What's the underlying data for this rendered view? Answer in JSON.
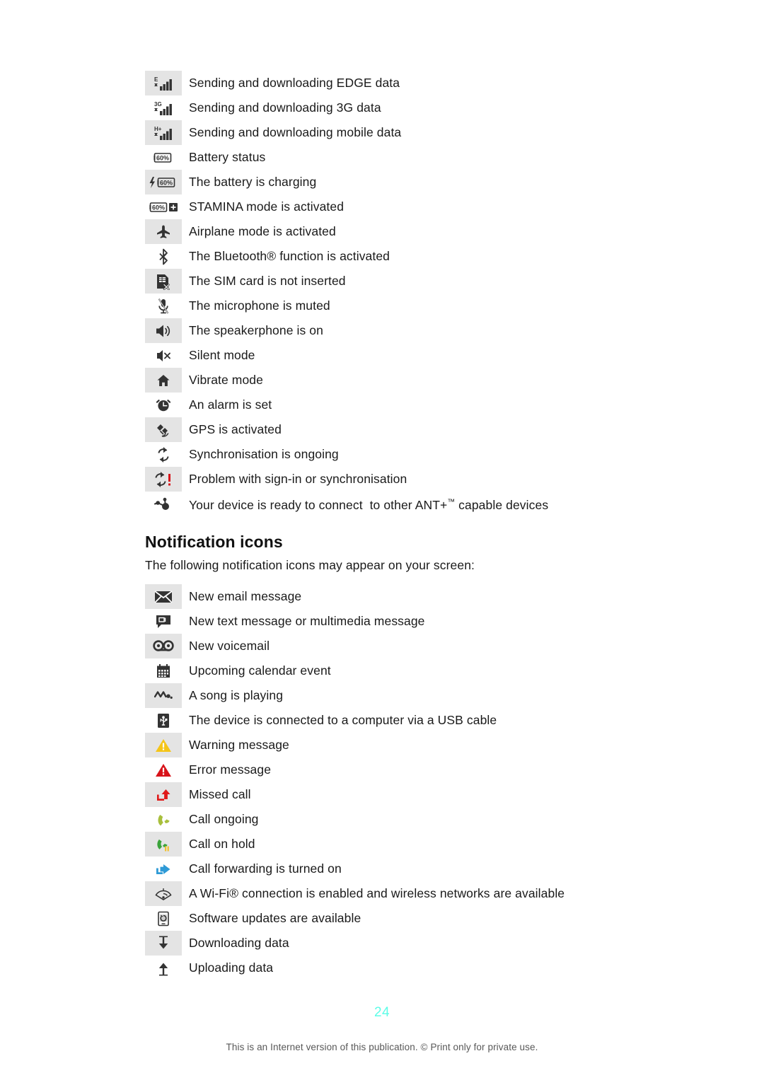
{
  "document": {
    "page_number": "24",
    "footer_note": "This is an Internet version of this publication. © Print only for private use."
  },
  "status_icons": {
    "rows": [
      {
        "icon": "edge-data-signal-icon",
        "label": "E",
        "description": "Sending and downloading EDGE data"
      },
      {
        "icon": "3g-data-signal-icon",
        "label": "3G",
        "description": "Sending and downloading 3G data"
      },
      {
        "icon": "mobile-data-signal-icon",
        "label": "H+",
        "description": "Sending and downloading mobile data"
      },
      {
        "icon": "battery-status-icon",
        "label": "60%",
        "description": "Battery status"
      },
      {
        "icon": "battery-charging-icon",
        "label": "60%",
        "description": "The battery is charging"
      },
      {
        "icon": "stamina-mode-icon",
        "label": "60%",
        "description": "STAMINA mode is activated"
      },
      {
        "icon": "airplane-mode-icon",
        "label": "",
        "description": "Airplane mode is activated"
      },
      {
        "icon": "bluetooth-icon",
        "label": "",
        "description": "The Bluetooth® function is activated"
      },
      {
        "icon": "sim-card-missing-icon",
        "label": "",
        "description": "The SIM card is not inserted"
      },
      {
        "icon": "microphone-muted-icon",
        "label": "",
        "description": "The microphone is muted"
      },
      {
        "icon": "speakerphone-icon",
        "label": "",
        "description": "The speakerphone is on"
      },
      {
        "icon": "silent-mode-icon",
        "label": "",
        "description": "Silent mode"
      },
      {
        "icon": "vibrate-mode-icon",
        "label": "",
        "description": "Vibrate mode"
      },
      {
        "icon": "alarm-set-icon",
        "label": "",
        "description": "An alarm is set"
      },
      {
        "icon": "gps-activated-icon",
        "label": "",
        "description": "GPS is activated"
      },
      {
        "icon": "sync-ongoing-icon",
        "label": "",
        "description": "Synchronisation is ongoing"
      },
      {
        "icon": "sync-problem-icon",
        "label": "",
        "description": "Problem with sign-in or synchronisation"
      },
      {
        "icon": "ant-plus-icon",
        "label": "",
        "description": "Your device is ready to connect  to other ANT+™ capable devices"
      }
    ]
  },
  "notification_section": {
    "heading": "Notification icons",
    "intro": "The following notification icons may appear on your screen:",
    "rows": [
      {
        "icon": "new-email-icon",
        "description": "New email message"
      },
      {
        "icon": "new-text-message-icon",
        "description": "New text message or multimedia message"
      },
      {
        "icon": "new-voicemail-icon",
        "description": "New voicemail"
      },
      {
        "icon": "calendar-event-icon",
        "description": "Upcoming calendar event"
      },
      {
        "icon": "music-playing-icon",
        "description": "A song is playing"
      },
      {
        "icon": "usb-connected-icon",
        "description": "The device is connected to a computer via a USB cable"
      },
      {
        "icon": "warning-icon",
        "description": "Warning message"
      },
      {
        "icon": "error-icon",
        "description": "Error message"
      },
      {
        "icon": "missed-call-icon",
        "description": "Missed call"
      },
      {
        "icon": "call-ongoing-icon",
        "description": "Call ongoing"
      },
      {
        "icon": "call-on-hold-icon",
        "description": "Call on hold"
      },
      {
        "icon": "call-forwarding-icon",
        "description": "Call forwarding is turned on"
      },
      {
        "icon": "wifi-available-icon",
        "description": "A Wi-Fi® connection is enabled and wireless networks are available"
      },
      {
        "icon": "software-update-icon",
        "description": "Software updates are available"
      },
      {
        "icon": "downloading-data-icon",
        "description": "Downloading data"
      },
      {
        "icon": "uploading-data-icon",
        "description": "Uploading data"
      }
    ]
  },
  "colors": {
    "cell_shade": "#e4e4e4",
    "icon_dark": "#333333",
    "page_number": "#5dfde7",
    "warning_yellow": "#f5c518",
    "error_red": "#d8131a",
    "missed_call_red": "#e01a1a",
    "call_green": "#a8bf3c",
    "call_hold_green": "#3aa33a",
    "call_forward_blue": "#2e9ad6"
  }
}
